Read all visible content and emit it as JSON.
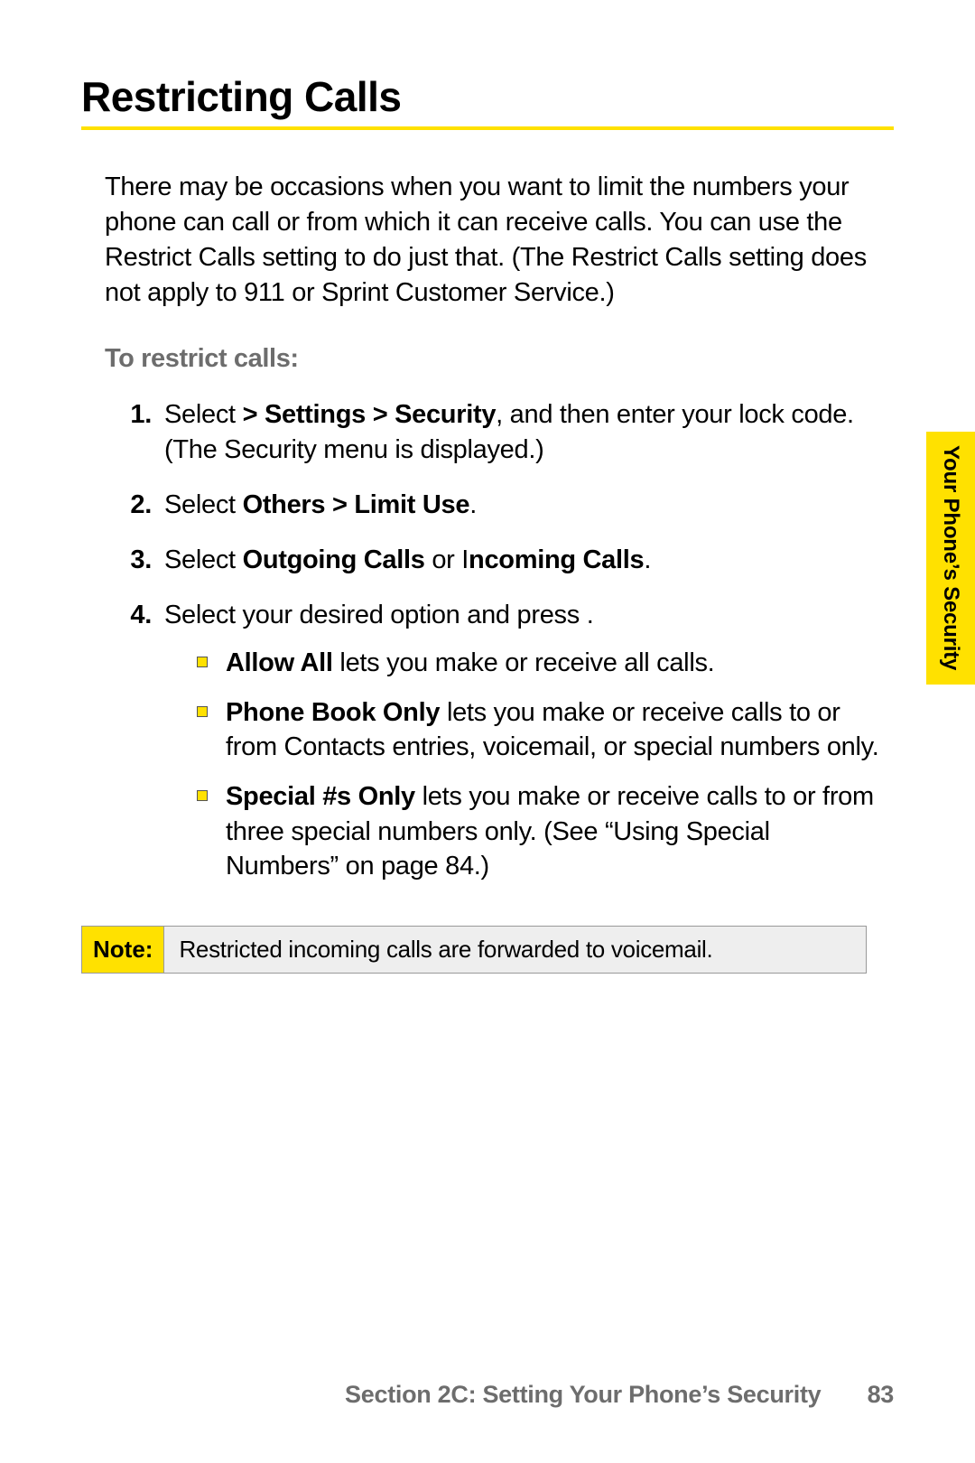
{
  "heading": "Restricting Calls",
  "intro": "There may be occasions when you want to limit the numbers your phone can call or from which it can receive calls. You can use the Restrict Calls setting to do just that. (The Restrict Calls setting does not apply to 911 or Sprint Customer Service.)",
  "subhead": "To restrict calls:",
  "steps": {
    "s1_num": "1.",
    "s1_a": "Select ",
    "s1_bold": " > Settings > Security",
    "s1_b": ", and then enter your lock code. (The Security menu is displayed.)",
    "s2_num": "2.",
    "s2_a": "Select ",
    "s2_bold": "Others > Limit Use",
    "s2_b": ".",
    "s3_num": "3.",
    "s3_a": "Select ",
    "s3_bold1": "Outgoing Calls",
    "s3_mid": " or I",
    "s3_bold2": "ncoming Calls",
    "s3_b": ".",
    "s4_num": "4.",
    "s4_a": "Select your desired option and press ",
    "s4_gap": "     ",
    "s4_b": "."
  },
  "opts": {
    "o1_bold": "Allow All",
    "o1_rest": " lets you make or receive all calls.",
    "o2_bold": "Phone Book Only",
    "o2_rest": " lets you make or receive calls to or from Contacts entries, voicemail, or special numbers only.",
    "o3_bold": "Special #s Only",
    "o3_rest": " lets you make or receive calls to or from three special numbers only. (See “Using Special Numbers” on page 84.)"
  },
  "note_label": "Note:",
  "note_text": "Restricted incoming calls are forwarded to voicemail.",
  "side_tab": "Your Phone’s Security",
  "footer_section": "Section 2C: Setting Your Phone’s Security",
  "footer_page": "83"
}
